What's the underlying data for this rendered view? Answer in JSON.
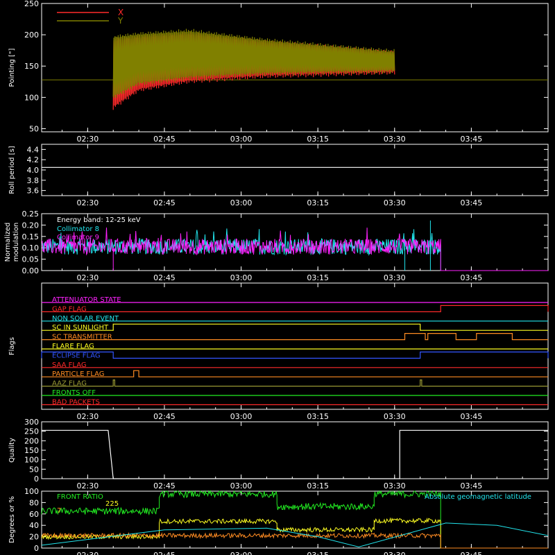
{
  "colors": {
    "background": "#000000",
    "axis": "#ffffff",
    "red": "#ff2a2a",
    "olive": "#808000",
    "white": "#ffffff",
    "cyan": "#22e6ee",
    "magenta": "#ff22ff",
    "green": "#22ee22",
    "yellow": "#ffff22",
    "orange": "#ff8c22",
    "blue": "#3355ff",
    "brown": "#7a7a22",
    "olive_flag": "#9a9a33"
  },
  "time_axis": {
    "range": [
      "02:21",
      "04:00"
    ],
    "tick_labels": [
      "02:30",
      "02:45",
      "03:00",
      "03:15",
      "03:30",
      "03:45"
    ]
  },
  "chart_data": [
    {
      "id": "pointing",
      "type": "line",
      "ylabel": "Pointing [\"]",
      "ylim": [
        45,
        250
      ],
      "yticks": [
        "50",
        "100",
        "150",
        "200",
        "250"
      ],
      "legend": {
        "position": "top-left",
        "entries": [
          {
            "label": "X",
            "color": "#ff2a2a"
          },
          {
            "label": "Y",
            "color": "#808000"
          }
        ]
      },
      "series": [
        {
          "name": "X",
          "start": "02:35",
          "end": "03:30",
          "envelope_low": [
            [
              0,
              80
            ],
            [
              5,
              108
            ],
            [
              15,
              122
            ],
            [
              30,
              130
            ],
            [
              55,
              136
            ]
          ],
          "envelope_high": [
            [
              0,
              195
            ],
            [
              5,
              200
            ],
            [
              15,
              205
            ],
            [
              30,
              192
            ],
            [
              55,
              175
            ]
          ]
        },
        {
          "name": "Y",
          "start": "02:35",
          "end": "03:30",
          "envelope_low": [
            [
              0,
              96
            ],
            [
              5,
              118
            ],
            [
              15,
              128
            ],
            [
              30,
              134
            ],
            [
              55,
              138
            ]
          ],
          "envelope_high": [
            [
              0,
              200
            ],
            [
              5,
              205
            ],
            [
              15,
              210
            ],
            [
              30,
              195
            ],
            [
              55,
              177
            ]
          ]
        }
      ],
      "baseline": 128
    },
    {
      "id": "roll-period",
      "type": "line",
      "ylabel": "Roll period [s]",
      "ylim": [
        3.5,
        4.5
      ],
      "yticks": [
        "3.6",
        "3.8",
        "4.0",
        "4.2",
        "4.4"
      ],
      "value": 4.05
    },
    {
      "id": "modulation",
      "type": "line",
      "ylabel": "Normalized modulation",
      "ylim": [
        0,
        0.25
      ],
      "yticks": [
        "0.00",
        "0.05",
        "0.10",
        "0.15",
        "0.20",
        "0.25"
      ],
      "annotation": "Energy band: 12-25 keV",
      "series": [
        {
          "name": "Collimator 8",
          "color": "#22e6ee",
          "mean": 0.105,
          "start": "02:21",
          "end": "03:39"
        },
        {
          "name": "Collimator 9",
          "color": "#ff22ff",
          "mean": 0.105,
          "start": "02:21",
          "end": "03:39"
        }
      ]
    },
    {
      "id": "flags",
      "type": "line",
      "ylabel": "Flags",
      "flags": [
        {
          "label": "ATTENUATOR STATE",
          "color": "#ff22ff",
          "segments": []
        },
        {
          "label": "GAP FLAG",
          "color": "#ff2a2a",
          "segments": [
            [
              "03:39",
              "04:00"
            ]
          ]
        },
        {
          "label": "NON SOLAR EVENT",
          "color": "#22e6ee",
          "segments": []
        },
        {
          "label": "SC IN SUNLIGHT",
          "color": "#ffff22",
          "segments": [
            [
              "02:35",
              "03:35"
            ]
          ]
        },
        {
          "label": "SC TRANSMITTER",
          "color": "#ff8c22",
          "segments": [
            [
              "03:32",
              "03:36"
            ],
            [
              "03:36.5",
              "03:42"
            ],
            [
              "03:46",
              "03:53"
            ]
          ]
        },
        {
          "label": "FLARE FLAG",
          "color": "#ffff22",
          "segments": []
        },
        {
          "label": "ECLIPSE FLAG",
          "color": "#3355ff",
          "segments": [
            [
              "02:21",
              "02:35"
            ],
            [
              "03:35",
              "04:00"
            ]
          ]
        },
        {
          "label": "SAA FLAG",
          "color": "#ff2a2a",
          "segments": []
        },
        {
          "label": "PARTICLE FLAG",
          "color": "#ff8c22",
          "segments": [
            [
              "02:39",
              "02:40"
            ]
          ]
        },
        {
          "label": "AAZ FLAG",
          "color": "#9a9a33",
          "segments": [
            [
              "02:35",
              "02:35.3"
            ],
            [
              "03:35",
              "03:35.3"
            ]
          ]
        },
        {
          "label": "FRONTS OFF",
          "color": "#22ee22",
          "segments": []
        },
        {
          "label": "BAD PACKETS",
          "color": "#ff2a2a",
          "segments": []
        }
      ]
    },
    {
      "id": "quality",
      "type": "line",
      "ylabel": "Quality",
      "ylim": [
        0,
        300
      ],
      "yticks": [
        "0",
        "50",
        "100",
        "150",
        "200",
        "250",
        "300"
      ],
      "points": [
        [
          "02:21",
          255
        ],
        [
          "02:34",
          255
        ],
        [
          "02:35",
          0
        ],
        [
          "03:31",
          0
        ],
        [
          "03:31",
          255
        ],
        [
          "04:00",
          255
        ]
      ]
    },
    {
      "id": "geomag",
      "type": "line",
      "ylabel": "Degrees or %",
      "ylim": [
        0,
        100
      ],
      "yticks": [
        "0",
        "20",
        "40",
        "60",
        "80",
        "100"
      ],
      "legend_entries": [
        {
          "label": "FRONT RATIO",
          "color": "#22ee22"
        },
        {
          "label": "225",
          "color": "#ffff22"
        },
        {
          "label": "7",
          "color": "#ff8c22"
        }
      ],
      "annotation": "Absolute geomagnetic latitude",
      "series": [
        {
          "name": "FRONT RATIO",
          "color": "#22ee22",
          "levels": [
            [
              "02:21",
              "02:44",
              65
            ],
            [
              "02:44",
              "03:07",
              95
            ],
            [
              "03:07",
              "03:26",
              73
            ],
            [
              "03:26",
              "03:39",
              95
            ]
          ]
        },
        {
          "name": "225",
          "color": "#ffff22",
          "levels": [
            [
              "02:21",
              "02:44",
              20
            ],
            [
              "02:44",
              "03:07",
              47
            ],
            [
              "03:07",
              "03:26",
              32
            ],
            [
              "03:26",
              "03:39",
              48
            ]
          ]
        },
        {
          "name": "7",
          "color": "#ff8c22",
          "levels": [
            [
              "02:21",
              "03:39",
              22
            ]
          ]
        },
        {
          "name": "Absolute geomagnetic latitude",
          "color": "#22e6ee",
          "curve": [
            [
              "02:21",
              5
            ],
            [
              "02:45",
              32
            ],
            [
              "03:05",
              35
            ],
            [
              "03:15",
              20
            ],
            [
              "03:23",
              2
            ],
            [
              "03:40",
              44
            ],
            [
              "03:50",
              40
            ],
            [
              "04:00",
              22
            ]
          ]
        }
      ]
    }
  ]
}
